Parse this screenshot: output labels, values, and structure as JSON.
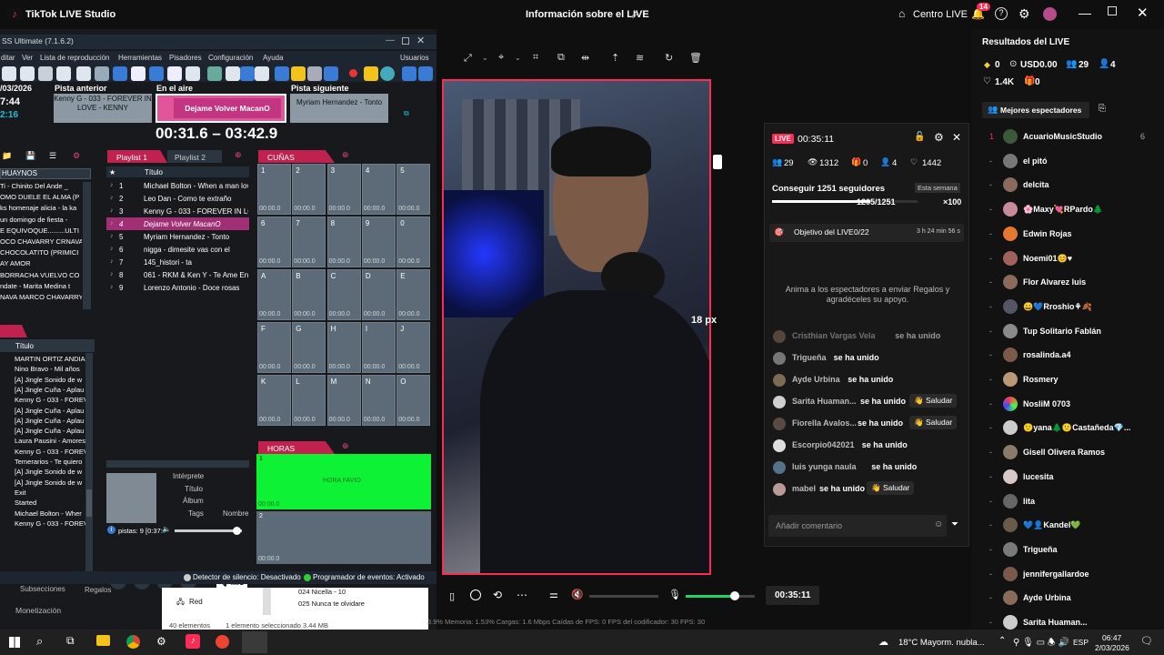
{
  "titlebar": {
    "app_name": "TikTok LIVE Studio",
    "center_title": "Información sobre el LIVE",
    "centro_live": "Centro LIVE",
    "notif_count": "14"
  },
  "radio": {
    "window_title": "SS Ultimate (7.1.6.2)",
    "menu": [
      "ditar",
      "Ver",
      "Lista de reproducción",
      "Herramientas",
      "Pisadores",
      "Configuración",
      "Ayuda"
    ],
    "usuarios": "Usuarios",
    "date": "/03/2026",
    "time": "7:44",
    "time2": "2:16",
    "prev_label": "Pista anterior",
    "prev_track": "Kenny G - 033 - FOREVER IN LOVE - KENNY",
    "onair_label": "En el aire",
    "onair_track": "Dejame Volver MacanO",
    "next_label": "Pista siguiente",
    "next_track": "Myriam Hernandez - Tonto",
    "timer": "00:31.6 – 03:42.9",
    "genre_select": "HUAYNOS",
    "genre_list": [
      "Ti - Chinito Del Ande _",
      "OMO DUELE EL ALMA (P",
      "ks homenaje alicia - la ka",
      "un domingo de fiesta -",
      "E EQUIVOQUE.........ULTI",
      "OCO CHAVARRY CRNAVAL",
      "CHOCOLATITO (PRIMICI",
      "AY AMOR",
      "BORRACHA VUELVO CO",
      "ndate - Marita Medina t",
      "NAVA MARCO CHAVARRY"
    ],
    "playlist_tabs": [
      "Playlist 1",
      "Playlist 2"
    ],
    "playlist_header": "Título",
    "playlist": [
      {
        "n": "1",
        "t": "Michael Bolton - When a man lov"
      },
      {
        "n": "2",
        "t": "Leo Dan - Como te extraño"
      },
      {
        "n": "3",
        "t": "Kenny G - 033 - FOREVER IN LOVE"
      },
      {
        "n": "4",
        "t": "Dejame Volver MacanO"
      },
      {
        "n": "5",
        "t": "Myriam Hernandez - Tonto"
      },
      {
        "n": "6",
        "t": "nigga - dimesite vas con el"
      },
      {
        "n": "7",
        "t": "145_histori - ta"
      },
      {
        "n": "8",
        "t": "061 - RKM & Ken Y - Te Ame En Mi"
      },
      {
        "n": "9",
        "t": "Lorenzo Antonio - Doce rosas"
      }
    ],
    "cunas_tab": "CUÑAS",
    "cunas_labels": [
      "1",
      "2",
      "3",
      "4",
      "5",
      "6",
      "7",
      "8",
      "9",
      "0",
      "A",
      "B",
      "C",
      "D",
      "E",
      "F",
      "G",
      "H",
      "I",
      "J",
      "K",
      "L",
      "M",
      "N",
      "O"
    ],
    "cunas_time": "00:00.0",
    "horas_tab": "HORAS",
    "hora_favio": "HORA FAVIO",
    "hora1": "1",
    "hora2": "2",
    "hora_time": "00:00.0",
    "lib_header": "Título",
    "library": [
      "MARTIN ORTIZ ANDIA",
      "Nino Bravo - Mil años",
      "[A] Jingle Sonido de w",
      "[A] Jingle Cuña - Aplau",
      "Kenny G - 033 - FOREV",
      "[A] Jingle Cuña - Aplau",
      "[A] Jingle Cuña - Aplau",
      "[A] Jingle Cuña - Aplau",
      "Laura Pausini - Amores",
      "Kenny G - 033 - FOREV",
      "Temerarios - Te quiero",
      "[A] Jingle Sonido de w",
      "[A] Jingle Sonido de w",
      "Exit",
      "Started",
      "Michael Bolton - Wher",
      "Kenny G - 033 - FOREV"
    ],
    "meta": {
      "interprete": "Intérprete",
      "titulo": "Título",
      "album": "Álbum",
      "tags": "Tags",
      "nombre": "Nombre"
    },
    "pistas": "pistas: 9 [0:37:",
    "mic": "MIC",
    "status1": "Detector de silencio: Desactivado",
    "status2": "Programador de eventos: Activado"
  },
  "explorer": {
    "red": "Red",
    "items": [
      "024 Nicella - 10",
      "025 Nunca te olvidare"
    ],
    "count": "40 elementos",
    "selected": "1 elemento seleccionado  3.44 MB"
  },
  "behind": {
    "b1": "Subsecciones",
    "b2": "Regalos",
    "b3": "Monetización"
  },
  "preview": {
    "px_label": "18 px"
  },
  "live_popup": {
    "live_badge": "LIVE",
    "timer": "00:35:11",
    "stats": [
      "29",
      "1312",
      "0",
      "4",
      "1442"
    ],
    "goal_title": "Conseguir 1251 seguidores",
    "goal_tag": "Esta semana",
    "goal_progress": "1205/1251",
    "goal_reward": "×100",
    "objective": "Objetivo del LIVE",
    "objective_count": "0/22",
    "objective_time": "3 h 24 min 56 s",
    "encourage": "Anima a los espectadores a enviar Regalos y agradéceles su apoyo.",
    "chat": [
      {
        "name": "Cristhian Vargas Vela",
        "msg": "se ha unido",
        "btn": ""
      },
      {
        "name": "Trigueña",
        "msg": "se ha unido",
        "btn": ""
      },
      {
        "name": "Ayde Urbina",
        "msg": "se ha unido",
        "btn": ""
      },
      {
        "name": "Sarita Huaman...",
        "msg": "se ha unido",
        "btn": "Saludar"
      },
      {
        "name": "Fiorella Avalos...",
        "msg": "se ha unido",
        "btn": "Saludar"
      },
      {
        "name": "Escorpio042021",
        "msg": "se ha unido",
        "btn": ""
      },
      {
        "name": "luis yunga naula",
        "msg": "se ha unido",
        "btn": ""
      },
      {
        "name": "mabel",
        "msg": "se ha unido",
        "btn": "Saludar"
      }
    ],
    "comment_placeholder": "Añadir comentario"
  },
  "bottom_bar": {
    "timer": "00:35:11",
    "stats": "3.9%     Memoria: 1.53%     Cargas: 1.6 Mbps     Caídas de FPS: 0     FPS del codificador: 30     FPS: 30"
  },
  "results": {
    "title": "Resultados del LIVE",
    "coins": "0",
    "usd": "USD0.00",
    "viewers": "29",
    "follow": "4",
    "likes": "1.4K",
    "gifts": "0",
    "top_btn": "Mejores espectadores",
    "viewers_list": [
      {
        "rank": "1",
        "name": "AcuarioMusicStudio",
        "score": "6"
      },
      {
        "rank": "-",
        "name": "el pitó",
        "score": ""
      },
      {
        "rank": "-",
        "name": "delcita",
        "score": ""
      },
      {
        "rank": "-",
        "name": "🌸Maxy💘RPardo🌲",
        "score": ""
      },
      {
        "rank": "-",
        "name": "Edwin Rojas",
        "score": ""
      },
      {
        "rank": "-",
        "name": "Noemi01😊♥",
        "score": ""
      },
      {
        "rank": "-",
        "name": "Flor Alvarez luis",
        "score": ""
      },
      {
        "rank": "-",
        "name": "😀💙Rroshio⚘🍂",
        "score": ""
      },
      {
        "rank": "-",
        "name": "Tup Solitario Fablán",
        "score": ""
      },
      {
        "rank": "-",
        "name": "rosalinda.a4",
        "score": ""
      },
      {
        "rank": "-",
        "name": "Rosmery",
        "score": ""
      },
      {
        "rank": "-",
        "name": "NosliM 0703",
        "score": ""
      },
      {
        "rank": "-",
        "name": "🙂yana🌲🙂Castañeda💎...",
        "score": ""
      },
      {
        "rank": "-",
        "name": "Gisell Olivera Ramos",
        "score": ""
      },
      {
        "rank": "-",
        "name": "lucesita",
        "score": ""
      },
      {
        "rank": "-",
        "name": "lita",
        "score": ""
      },
      {
        "rank": "-",
        "name": "💙👤Kandel💚",
        "score": ""
      },
      {
        "rank": "-",
        "name": "Trigueña",
        "score": ""
      },
      {
        "rank": "-",
        "name": "jennifergallardoe",
        "score": ""
      },
      {
        "rank": "-",
        "name": "Ayde Urbina",
        "score": ""
      },
      {
        "rank": "-",
        "name": "Sarita Huaman...",
        "score": ""
      }
    ]
  },
  "taskbar": {
    "weather": "18°C  Mayorm. nubla...",
    "lang": "ESP",
    "time": "06:47",
    "date": "2/03/2026"
  }
}
